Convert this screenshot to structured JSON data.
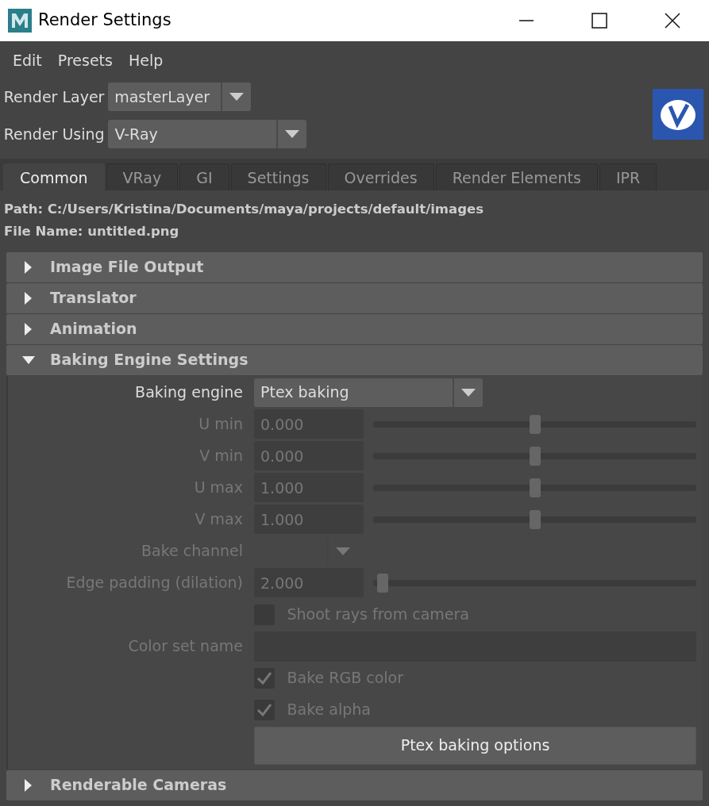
{
  "window": {
    "title": "Render Settings"
  },
  "menu": [
    {
      "label": "Edit"
    },
    {
      "label": "Presets"
    },
    {
      "label": "Help"
    }
  ],
  "render_layer": {
    "label": "Render Layer",
    "value": "masterLayer"
  },
  "render_using": {
    "label": "Render Using",
    "value": "V-Ray"
  },
  "tabs": [
    {
      "label": "Common",
      "selected": true
    },
    {
      "label": "VRay",
      "selected": false
    },
    {
      "label": "GI",
      "selected": false
    },
    {
      "label": "Settings",
      "selected": false
    },
    {
      "label": "Overrides",
      "selected": false
    },
    {
      "label": "Render Elements",
      "selected": false
    },
    {
      "label": "IPR",
      "selected": false
    }
  ],
  "path": "Path: C:/Users/Kristina/Documents/maya/projects/default/images",
  "file_name": "File Name: untitled.png",
  "sections": [
    {
      "title": "Image File Output",
      "expanded": false
    },
    {
      "title": "Translator",
      "expanded": false
    },
    {
      "title": "Animation",
      "expanded": false
    },
    {
      "title": "Baking Engine Settings",
      "expanded": true,
      "fields": [
        {
          "kind": "dropdown",
          "label": "Baking engine",
          "value": "Ptex baking",
          "disabled": false
        },
        {
          "kind": "slider",
          "label": "U min",
          "value": "0.000",
          "level": 0.5,
          "disabled": true
        },
        {
          "kind": "slider",
          "label": "V min",
          "value": "0.000",
          "level": 0.5,
          "disabled": true
        },
        {
          "kind": "slider",
          "label": "U max",
          "value": "1.000",
          "level": 0.5,
          "disabled": true
        },
        {
          "kind": "slider",
          "label": "V max",
          "value": "1.000",
          "level": 0.5,
          "disabled": true
        },
        {
          "kind": "dropdown",
          "label": "Bake channel",
          "disabled": true
        },
        {
          "kind": "slider",
          "label": "Edge padding (dilation)",
          "value": "2.000",
          "level": 0.03,
          "disabled": true
        },
        {
          "kind": "checkbox",
          "label": "Shoot rays from camera",
          "checked": false,
          "disabled": true
        },
        {
          "kind": "text",
          "label": "Color set name",
          "disabled": true
        },
        {
          "kind": "checkbox",
          "label": "Bake RGB color",
          "checked": true,
          "disabled": true
        },
        {
          "kind": "checkbox",
          "label": "Bake alpha",
          "checked": true,
          "disabled": true
        },
        {
          "kind": "button",
          "label": "Ptex baking options",
          "disabled": false
        }
      ]
    },
    {
      "title": "Renderable Cameras",
      "expanded": false
    }
  ]
}
